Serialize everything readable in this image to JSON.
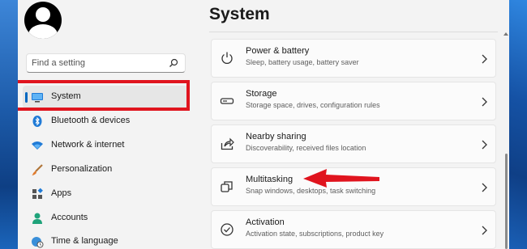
{
  "search": {
    "placeholder": "Find a setting"
  },
  "sidebar": {
    "items": [
      {
        "label": "System",
        "icon": "system-icon",
        "selected": true
      },
      {
        "label": "Bluetooth & devices",
        "icon": "bluetooth-icon"
      },
      {
        "label": "Network & internet",
        "icon": "wifi-icon"
      },
      {
        "label": "Personalization",
        "icon": "brush-icon"
      },
      {
        "label": "Apps",
        "icon": "apps-icon"
      },
      {
        "label": "Accounts",
        "icon": "person-icon"
      },
      {
        "label": "Time & language",
        "icon": "globe-clock-icon"
      }
    ]
  },
  "main": {
    "title": "System",
    "cards": [
      {
        "title": "Power & battery",
        "subtitle": "Sleep, battery usage, battery saver",
        "icon": "power-icon"
      },
      {
        "title": "Storage",
        "subtitle": "Storage space, drives, configuration rules",
        "icon": "storage-icon"
      },
      {
        "title": "Nearby sharing",
        "subtitle": "Discoverability, received files location",
        "icon": "share-icon"
      },
      {
        "title": "Multitasking",
        "subtitle": "Snap windows, desktops, task switching",
        "icon": "multitasking-icon"
      },
      {
        "title": "Activation",
        "subtitle": "Activation state, subscriptions, product key",
        "icon": "check-circle-icon"
      }
    ]
  },
  "colors": {
    "accent": "#0067c0",
    "annotation_red": "#e0141e",
    "window_bg": "#f3f3f3",
    "card_bg": "#fbfbfb"
  }
}
